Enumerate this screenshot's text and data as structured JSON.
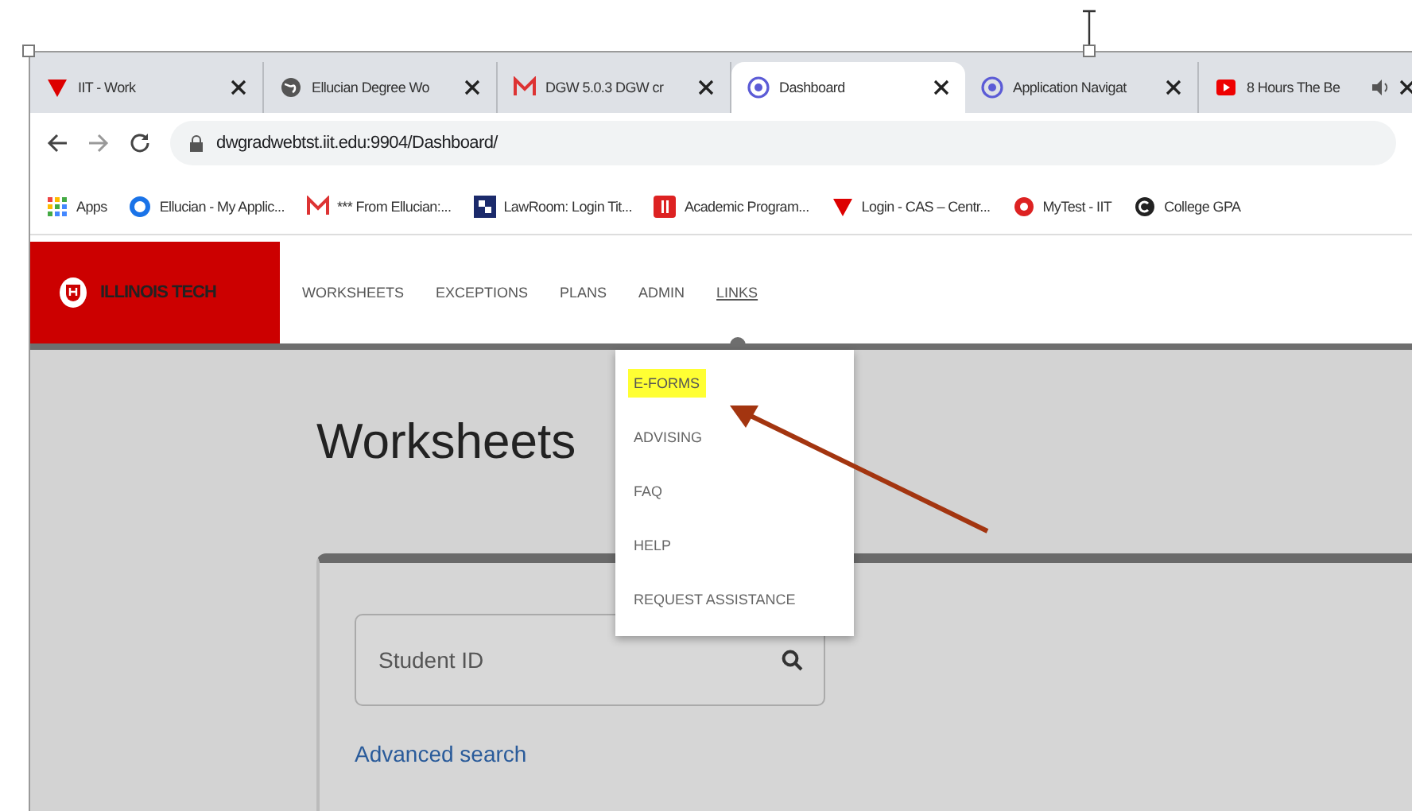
{
  "browser": {
    "tabs": [
      {
        "title": "IIT - Work",
        "selected": false,
        "audio": false
      },
      {
        "title": "Ellucian Degree Wo",
        "selected": false,
        "audio": false
      },
      {
        "title": "DGW 5.0.3 DGW cr",
        "selected": false,
        "audio": false
      },
      {
        "title": "Dashboard",
        "selected": true,
        "audio": false
      },
      {
        "title": "Application Navigat",
        "selected": false,
        "audio": false
      },
      {
        "title": "8 Hours The Be",
        "selected": false,
        "audio": true
      }
    ],
    "address": "dwgradwebtst.iit.edu:9904/Dashboard/",
    "bookmarks": [
      "Apps",
      "Ellucian - My Applic...",
      "*** From Ellucian:...",
      "LawRoom: Login Tit...",
      "Academic Program...",
      "Login - CAS – Centr...",
      "MyTest - IIT",
      "College GPA"
    ]
  },
  "app": {
    "logo": "ILLINOIS TECH",
    "nav": [
      {
        "label": "WORKSHEETS",
        "selected": false
      },
      {
        "label": "EXCEPTIONS",
        "selected": false
      },
      {
        "label": "PLANS",
        "selected": false
      },
      {
        "label": "ADMIN",
        "selected": false
      },
      {
        "label": "LINKS",
        "selected": true
      }
    ],
    "menu": [
      {
        "label": "E-FORMS",
        "highlighted": true
      },
      {
        "label": "ADVISING",
        "highlighted": false
      },
      {
        "label": "FAQ",
        "highlighted": false
      },
      {
        "label": "HELP",
        "highlighted": false
      },
      {
        "label": "REQUEST ASSISTANCE",
        "highlighted": false
      }
    ],
    "heading": "Worksheets",
    "search": {
      "placeholder": "Student ID"
    },
    "advanced_link": "Advanced search"
  }
}
